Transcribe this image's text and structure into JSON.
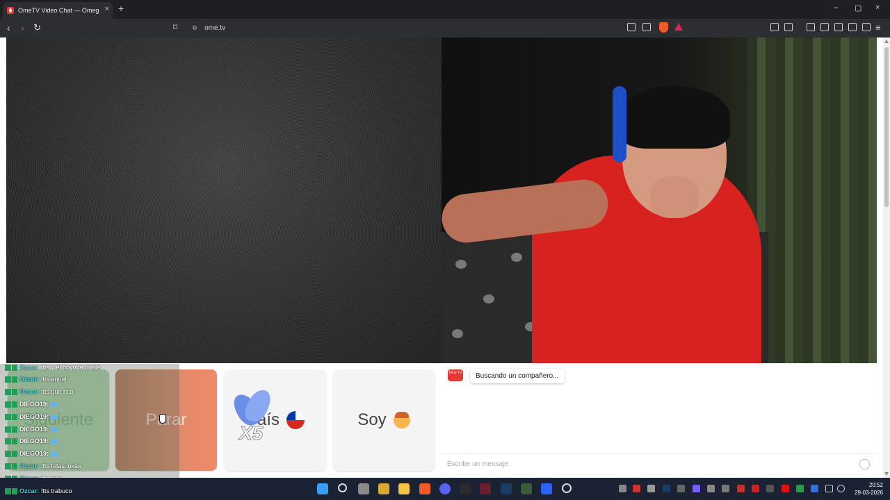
{
  "browser": {
    "tab_title": "OmeTV Video Chat — Omeg",
    "new_tab": "+",
    "tab_close": "×",
    "url": "ome.tv",
    "window_controls": {
      "minimize": "–",
      "maximize": "▢",
      "close": "×"
    }
  },
  "controls": {
    "next_label": "Siguiente",
    "stop_label": "Parar",
    "country_label": "País",
    "country_flag": "chile-flag",
    "soy_label": "Soy",
    "gift_overlay": "X5"
  },
  "chat_overlay": {
    "lines": [
      {
        "user": "Ozcar:",
        "message": "!tts y el hoyo te duele"
      },
      {
        "user": "Ozcar:",
        "message": "!tts anuel"
      },
      {
        "user": "Ozcar:",
        "message": "!tts que rico"
      },
      {
        "user": "DIEGO19:",
        "message": ""
      },
      {
        "user": "DIEGO19:",
        "message": ""
      },
      {
        "user": "DIEGO19:",
        "message": ""
      },
      {
        "user": "DIEGO19:",
        "message": ""
      },
      {
        "user": "DIEGO19:",
        "message": ""
      },
      {
        "user": "Ozcar:",
        "message": "!tts tetas lokas"
      },
      {
        "user": "Ozcar:",
        "message": "!tts pou"
      },
      {
        "user": "Ozcar:",
        "message": "!tts trabuco"
      }
    ]
  },
  "chat_panel": {
    "logo_text": "Ome TV",
    "status_message": "Buscando un compañero...",
    "input_placeholder": "Escribe un mensaje"
  },
  "taskbar": {
    "time": "20:52",
    "date": "29-03-2026"
  },
  "colors": {
    "next_button": "#aed8ae",
    "stop_button": "#f08a6a",
    "ome_red": "#e53935",
    "taskbar": "#1a2233"
  }
}
